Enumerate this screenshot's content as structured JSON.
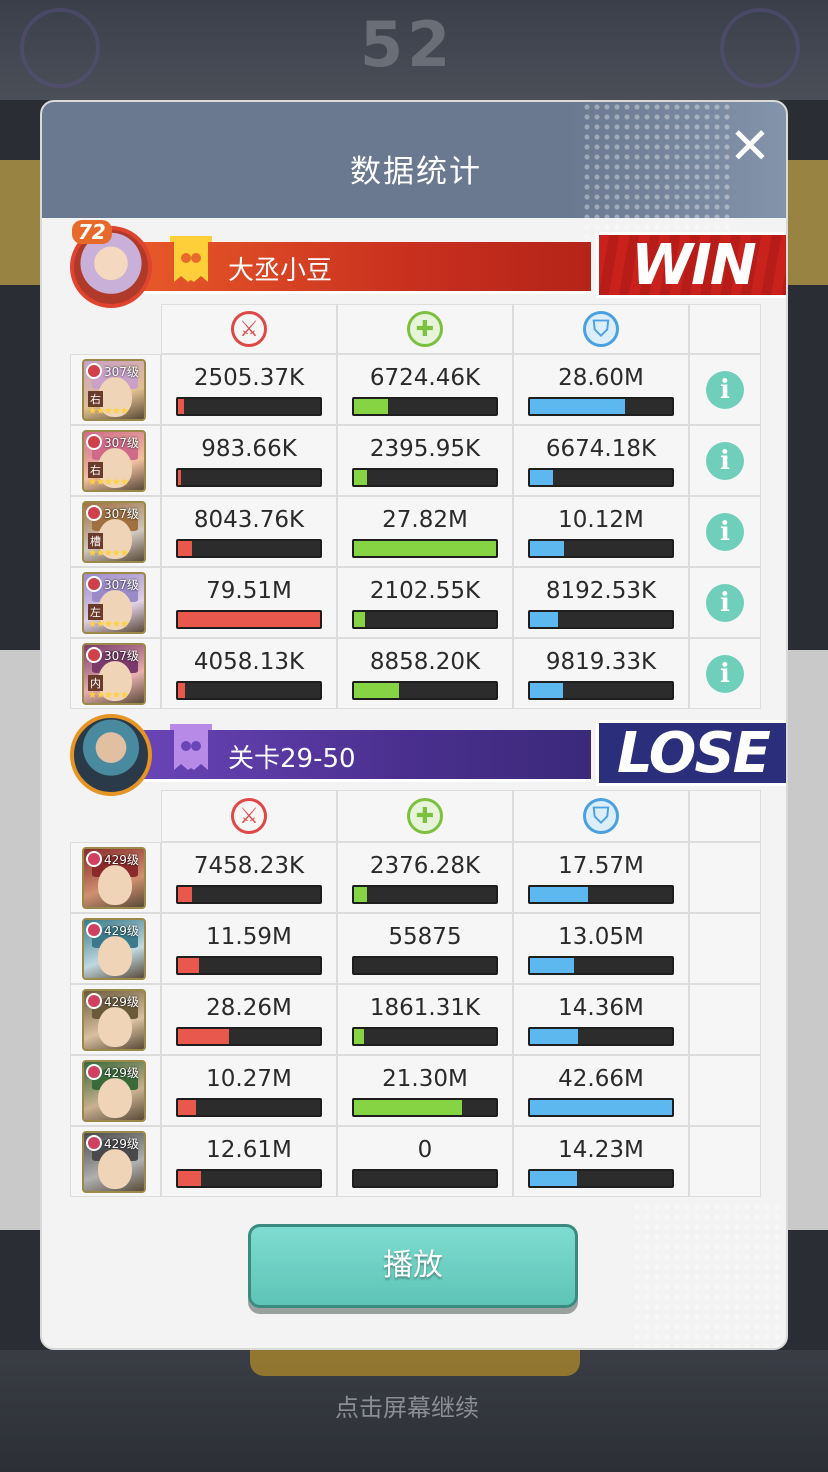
{
  "dialog": {
    "title": "数据统计",
    "play_label": "播放"
  },
  "background": {
    "score": "52",
    "bottom_text": "点击屏幕继续"
  },
  "colors": {
    "damage": "#e8584c",
    "heal": "#86d444",
    "defense": "#5cb8ee",
    "win": "#c9221c",
    "lose": "#2b2e7a"
  },
  "teams": [
    {
      "name": "大丞小豆",
      "level": "72",
      "result": "WIN",
      "heroes": [
        {
          "level": "307级",
          "pos": "右",
          "damage": "2505.37K",
          "heal": "6724.46K",
          "defense": "28.60M",
          "damage_pct": 4,
          "heal_pct": 24,
          "defense_pct": 67
        },
        {
          "level": "307级",
          "pos": "右",
          "damage": "983.66K",
          "heal": "2395.95K",
          "defense": "6674.18K",
          "damage_pct": 2,
          "heal_pct": 9,
          "defense_pct": 16
        },
        {
          "level": "307级",
          "pos": "槽",
          "damage": "8043.76K",
          "heal": "27.82M",
          "defense": "10.12M",
          "damage_pct": 10,
          "heal_pct": 100,
          "defense_pct": 24
        },
        {
          "level": "307级",
          "pos": "左",
          "damage": "79.51M",
          "heal": "2102.55K",
          "defense": "8192.53K",
          "damage_pct": 100,
          "heal_pct": 8,
          "defense_pct": 20
        },
        {
          "level": "307级",
          "pos": "内",
          "damage": "4058.13K",
          "heal": "8858.20K",
          "defense": "9819.33K",
          "damage_pct": 5,
          "heal_pct": 32,
          "defense_pct": 23
        }
      ]
    },
    {
      "name": "关卡29-50",
      "result": "LOSE",
      "heroes": [
        {
          "level": "429级",
          "damage": "7458.23K",
          "heal": "2376.28K",
          "defense": "17.57M",
          "damage_pct": 10,
          "heal_pct": 9,
          "defense_pct": 41
        },
        {
          "level": "429级",
          "damage": "11.59M",
          "heal": "55875",
          "defense": "13.05M",
          "damage_pct": 15,
          "heal_pct": 0,
          "defense_pct": 31
        },
        {
          "level": "429级",
          "damage": "28.26M",
          "heal": "1861.31K",
          "defense": "14.36M",
          "damage_pct": 36,
          "heal_pct": 7,
          "defense_pct": 34
        },
        {
          "level": "429级",
          "damage": "10.27M",
          "heal": "21.30M",
          "defense": "42.66M",
          "damage_pct": 13,
          "heal_pct": 76,
          "defense_pct": 100
        },
        {
          "level": "429级",
          "damage": "12.61M",
          "heal": "0",
          "defense": "14.23M",
          "damage_pct": 16,
          "heal_pct": 0,
          "defense_pct": 33
        }
      ]
    }
  ],
  "icons": {
    "damage": "sword-icon",
    "heal": "cross-icon",
    "defense": "shield-icon",
    "info": "info-icon",
    "close": "close-icon"
  }
}
